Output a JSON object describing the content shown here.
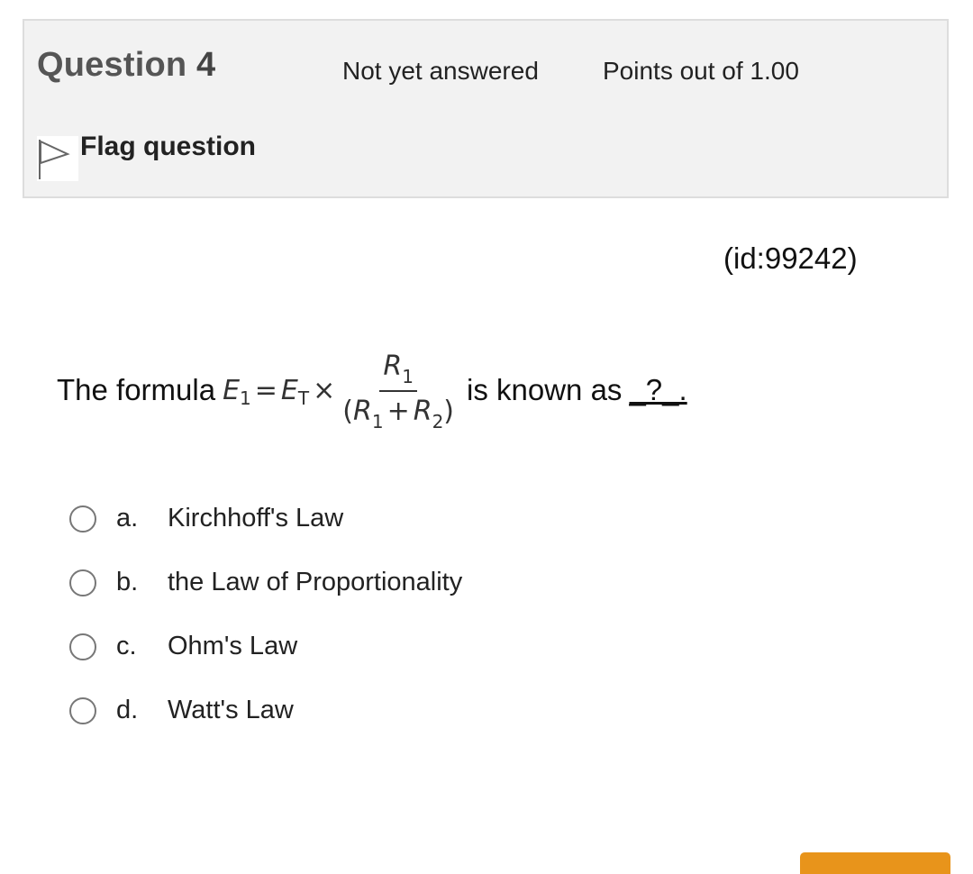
{
  "question_info": {
    "title_prefix": "Question",
    "number": "4",
    "state": "Not yet answered",
    "grade": "Points out of 1.00",
    "flag_label": "Flag question",
    "flag_icon": "flag-outline-icon"
  },
  "question": {
    "id_label": "(id:99242)",
    "text_before": "The formula",
    "text_after": "is known as",
    "blank": "_?_."
  },
  "formula": {
    "lhs_var": "E",
    "lhs_sub": "1",
    "eq": "=",
    "rhs_var": "E",
    "rhs_sub": "T",
    "times": "×",
    "num_var": "R",
    "num_sub": "1",
    "den_open": "(",
    "den_var1": "R",
    "den_sub1": "1",
    "den_plus": "+",
    "den_var2": "R",
    "den_sub2": "2",
    "den_close": ")"
  },
  "answers": [
    {
      "letter": "a.",
      "text": "Kirchhoff's Law"
    },
    {
      "letter": "b.",
      "text": "the Law of Proportionality"
    },
    {
      "letter": "c.",
      "text": "Ohm's Law"
    },
    {
      "letter": "d.",
      "text": "Watt's Law"
    }
  ],
  "colors": {
    "info_background": "#f2f2f2",
    "accent_button": "#e8941b"
  }
}
